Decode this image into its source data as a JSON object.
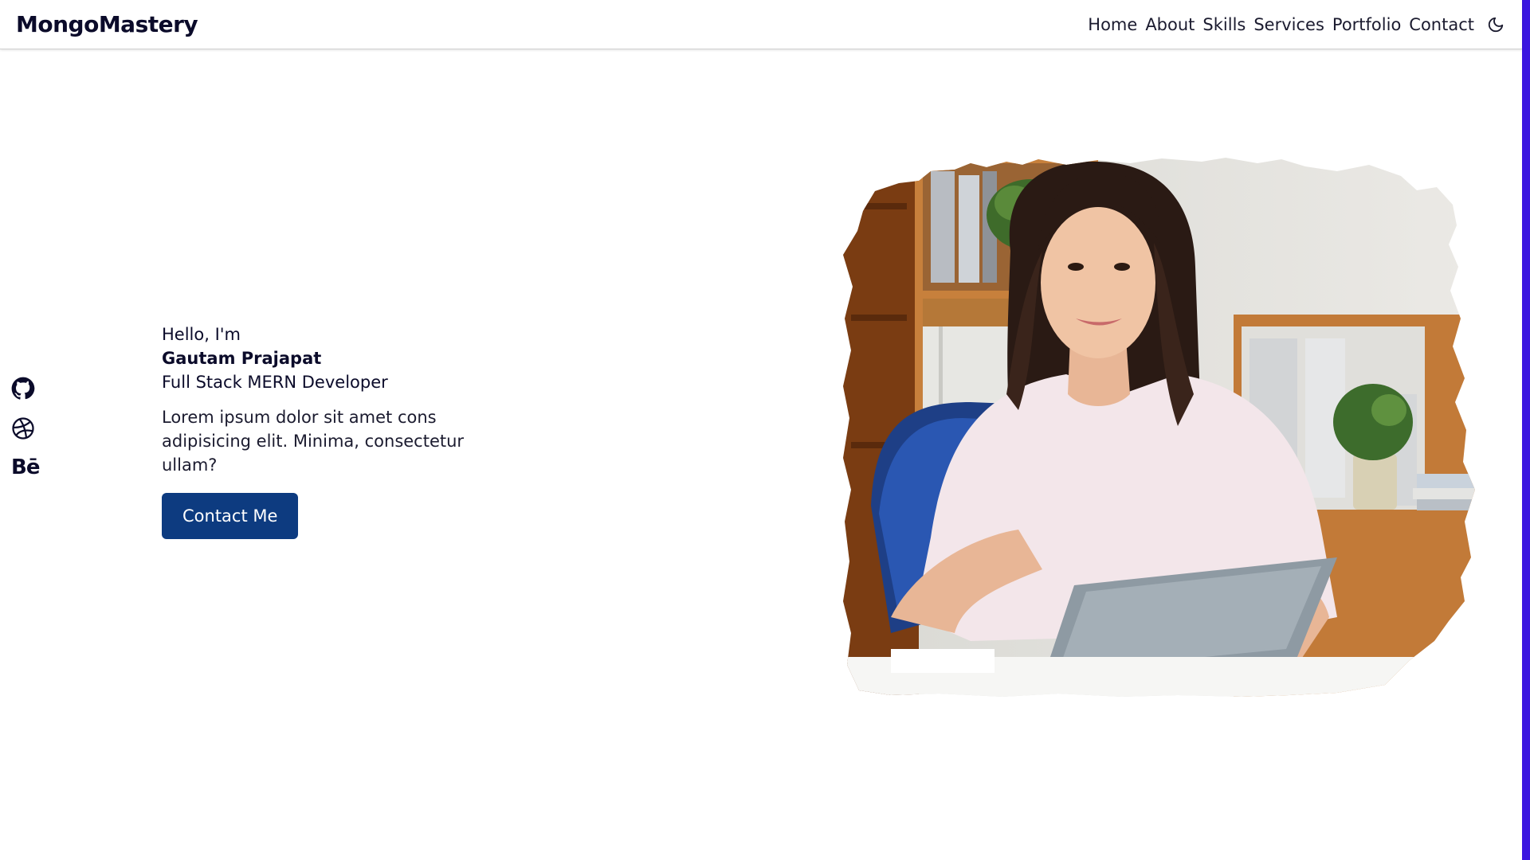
{
  "brand": {
    "logo": "MongoMastery"
  },
  "nav": {
    "items": [
      {
        "label": "Home"
      },
      {
        "label": "About"
      },
      {
        "label": "Skills"
      },
      {
        "label": "Services"
      },
      {
        "label": "Portfolio"
      },
      {
        "label": "Contact"
      }
    ],
    "theme_toggle_icon": "moon-icon"
  },
  "social": {
    "icons": [
      "github-icon",
      "dribbble-icon",
      "behance-icon"
    ],
    "behance_text": "Bē"
  },
  "hero": {
    "greeting": "Hello, I'm",
    "name": "Gautam Prajapat",
    "role": "Full Stack MERN Developer",
    "description": "Lorem ipsum dolor sit amet cons adipisicing elit. Minima, consectetur ullam?",
    "cta_label": "Contact Me",
    "image": "hero-portrait-woman-with-tablet"
  },
  "colors": {
    "primary": "#0d3b80",
    "text": "#0b0b2a",
    "accent_strip": "#3b16e0",
    "background": "#ffffff"
  }
}
